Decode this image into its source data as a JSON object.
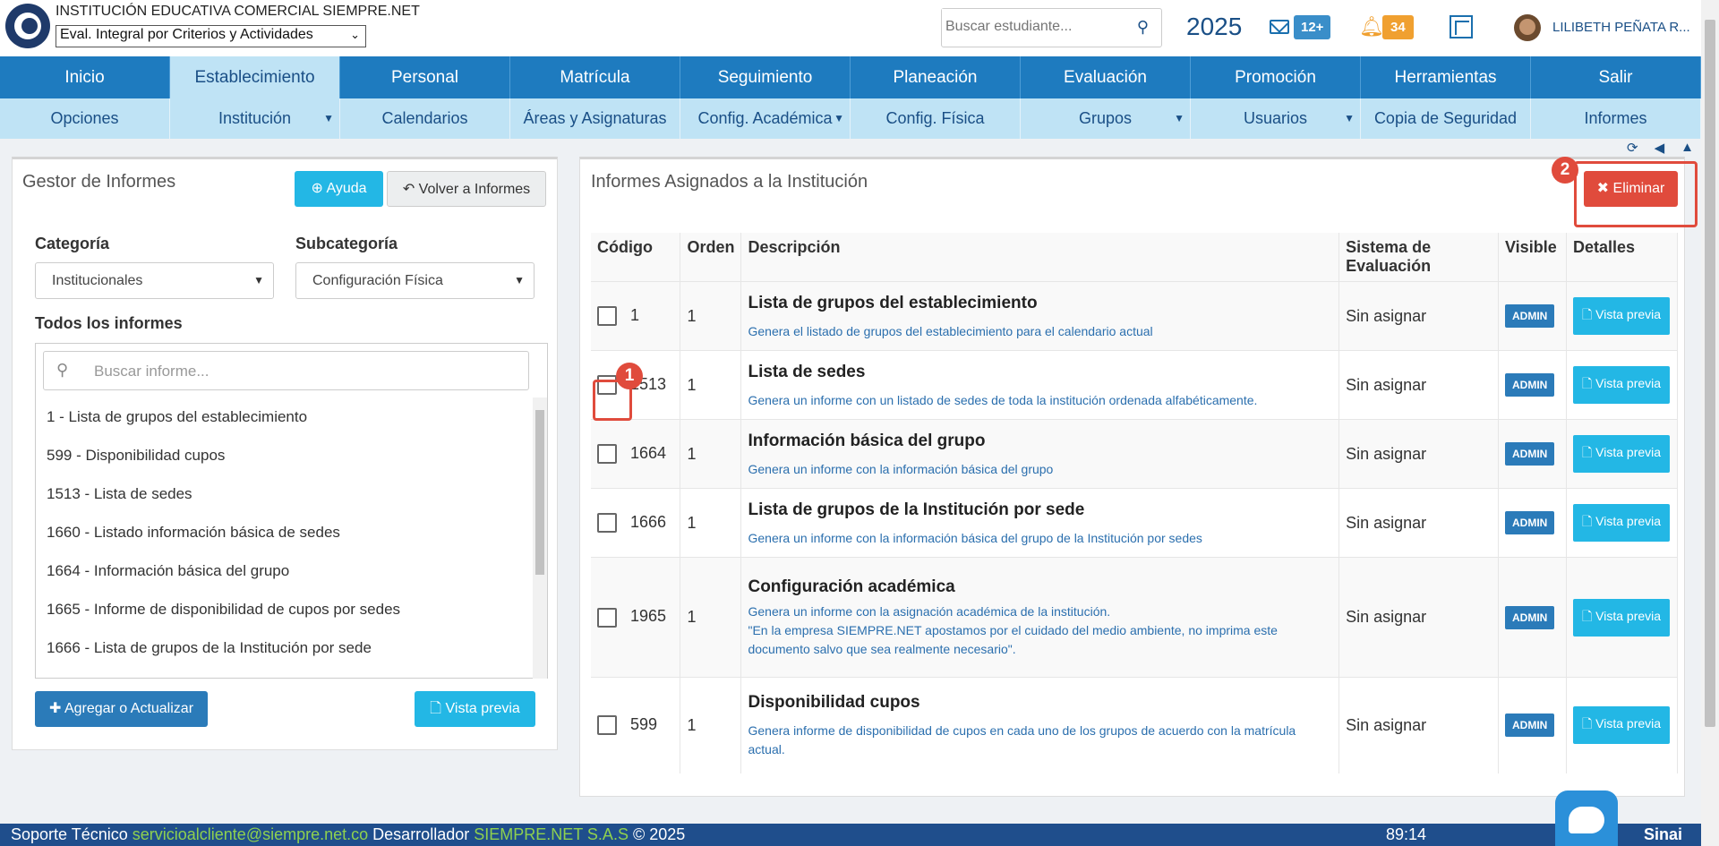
{
  "header": {
    "school_name": "INSTITUCIÓN EDUCATIVA COMERCIAL SIEMPRE.NET",
    "eval_select": "Eval. Integral por Criterios y Actividades",
    "search_placeholder": "Buscar estudiante...",
    "year": "2025",
    "messages_badge": "12+",
    "notifications_badge": "34",
    "username": "LILIBETH PEÑATA R..."
  },
  "nav_main": [
    "Inicio",
    "Establecimiento",
    "Personal",
    "Matrícula",
    "Seguimiento",
    "Planeación",
    "Evaluación",
    "Promoción",
    "Herramientas",
    "Salir"
  ],
  "nav_sub": [
    "Opciones",
    "Institución",
    "Calendarios",
    "Áreas y Asignaturas",
    "Config. Académica",
    "Config. Física",
    "Grupos",
    "Usuarios",
    "Copia de Seguridad",
    "Informes"
  ],
  "left_panel": {
    "title": "Gestor de Informes",
    "help_button": "Ayuda",
    "back_button": "Volver a Informes",
    "category_label": "Categoría",
    "category_value": "Institucionales",
    "subcategory_label": "Subcategoría",
    "subcategory_value": "Configuración Física",
    "all_reports_label": "Todos los informes",
    "search_placeholder": "Buscar informe...",
    "reports": [
      "1 - Lista de grupos del establecimiento",
      "599 - Disponibilidad cupos",
      "1513 - Lista de sedes",
      "1660 - Listado información básica de sedes",
      "1664 - Información básica del grupo",
      "1665 - Informe de disponibilidad de cupos por sedes",
      "1666 - Lista de grupos de la Institución por sede"
    ],
    "add_button": "Agregar o Actualizar",
    "preview_button": "Vista previa"
  },
  "right_panel": {
    "title": "Informes Asignados a la Institución",
    "delete_button": "Eliminar",
    "columns": {
      "code": "Código",
      "order": "Orden",
      "description": "Descripción",
      "system": "Sistema de Evaluación",
      "visible": "Visible",
      "details": "Detalles"
    },
    "rows": [
      {
        "code": "1",
        "order": "1",
        "title": "Lista de grupos del establecimiento",
        "desc": "Genera el listado de grupos del establecimiento para el calendario actual",
        "system": "Sin asignar",
        "visible": "ADMIN",
        "details": "Vista previa"
      },
      {
        "code": "1513",
        "order": "1",
        "title": "Lista de sedes",
        "desc": "Genera un informe con un listado de sedes de toda la institución ordenada alfabéticamente.",
        "system": "Sin asignar",
        "visible": "ADMIN",
        "details": "Vista previa"
      },
      {
        "code": "1664",
        "order": "1",
        "title": "Información básica del grupo",
        "desc": "Genera un informe con la información básica del grupo",
        "system": "Sin asignar",
        "visible": "ADMIN",
        "details": "Vista previa"
      },
      {
        "code": "1666",
        "order": "1",
        "title": "Lista de grupos de la Institución por sede",
        "desc": "Genera un informe con la información básica del grupo de la Institución por sedes",
        "system": "Sin asignar",
        "visible": "ADMIN",
        "details": "Vista previa"
      },
      {
        "code": "1965",
        "order": "1",
        "title": "Configuración académica",
        "desc": "Genera un informe con la asignación académica de la institución.",
        "desc2": "\"En la empresa SIEMPRE.NET apostamos por el cuidado del medio ambiente, no imprima este documento salvo que sea realmente necesario\".",
        "system": "Sin asignar",
        "visible": "ADMIN",
        "details": "Vista previa"
      },
      {
        "code": "599",
        "order": "1",
        "title": "Disponibilidad cupos",
        "desc": "Genera informe de disponibilidad de cupos en cada uno de los grupos de acuerdo con la matrícula actual.",
        "system": "Sin asignar",
        "visible": "ADMIN",
        "details": "Vista previa"
      }
    ]
  },
  "steps": [
    "1",
    "2"
  ],
  "footer": {
    "support_label": "Soporte Técnico",
    "support_email": "servicioalcliente@siempre.net.co",
    "dev_label": "Desarrollador",
    "dev_name": "SIEMPRE.NET S.A.S",
    "copyright": "© 2025",
    "time": "89:14",
    "brand": "Sinai"
  },
  "colors": {
    "nav_blue": "#1e7bbf",
    "nav_light": "#bfe3f5",
    "cyan": "#23b7e5",
    "red": "#e04b3c",
    "footer": "#1f4e8c"
  }
}
